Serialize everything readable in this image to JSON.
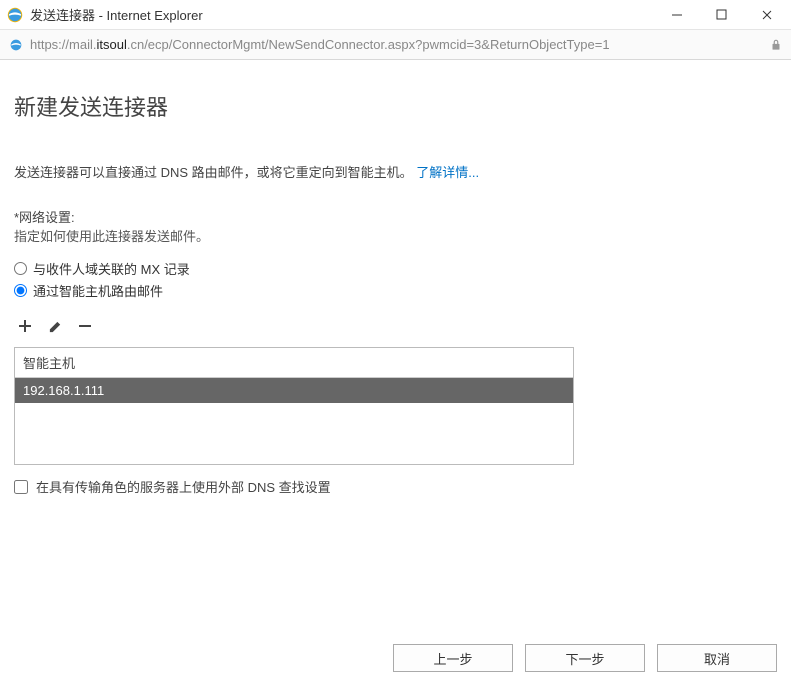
{
  "window": {
    "title": "发送连接器 - Internet Explorer"
  },
  "url": {
    "scheme": "https://",
    "sub": "mail.",
    "domain": "itsoul",
    "tld": ".cn",
    "path": "/ecp/ConnectorMgmt/NewSendConnector.aspx?pwmcid=3&ReturnObjectType=1"
  },
  "page": {
    "title": "新建发送连接器",
    "description": "发送连接器可以直接通过 DNS 路由邮件，或将它重定向到智能主机。",
    "learn_more": "了解详情...",
    "network_label": "*网络设置:",
    "network_sub": "指定如何使用此连接器发送邮件。",
    "radio_mx": "与收件人域关联的 MX 记录",
    "radio_smarthost": "通过智能主机路由邮件",
    "grid_header": "智能主机",
    "grid_rows": [
      "192.168.1.111"
    ],
    "checkbox_label": "在具有传输角色的服务器上使用外部 DNS 查找设置",
    "btn_back": "上一步",
    "btn_next": "下一步",
    "btn_cancel": "取消"
  }
}
